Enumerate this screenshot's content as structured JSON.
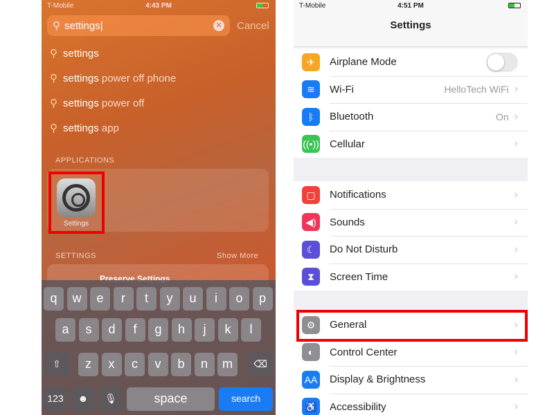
{
  "left": {
    "status": {
      "carrier": "T-Mobile",
      "time": "4:43 PM"
    },
    "search": {
      "value": "settings",
      "cancel": "Cancel"
    },
    "suggestions": [
      {
        "bold": "settings",
        "rest": ""
      },
      {
        "bold": "settings",
        "rest": " power off phone"
      },
      {
        "bold": "settings",
        "rest": " power off"
      },
      {
        "bold": "settings",
        "rest": " app"
      }
    ],
    "applications_header": "APPLICATIONS",
    "app": {
      "label": "Settings"
    },
    "settings_header": "SETTINGS",
    "show_more": "Show More",
    "partial_result": "Preserve Settings",
    "keyboard": {
      "row1": [
        "q",
        "w",
        "e",
        "r",
        "t",
        "y",
        "u",
        "i",
        "o",
        "p"
      ],
      "row2": [
        "a",
        "s",
        "d",
        "f",
        "g",
        "h",
        "j",
        "k",
        "l"
      ],
      "row3": [
        "z",
        "x",
        "c",
        "v",
        "b",
        "n",
        "m"
      ],
      "shift": "⇧",
      "delete": "⌫",
      "numbers": "123",
      "emoji": "☻",
      "mic": "🎙",
      "space": "space",
      "search": "search"
    }
  },
  "right": {
    "status": {
      "carrier": "T-Mobile",
      "time": "4:51 PM"
    },
    "title": "Settings",
    "groups": [
      [
        {
          "label": "Airplane Mode",
          "icon": "airplane-icon",
          "glyph": "✈",
          "color": "#f5a623",
          "toggle": false
        },
        {
          "label": "Wi-Fi",
          "icon": "wifi-icon",
          "glyph": "≋",
          "color": "#1a7cf5",
          "value": "HelloTech WiFi"
        },
        {
          "label": "Bluetooth",
          "icon": "bluetooth-icon",
          "glyph": "ᛒ",
          "color": "#1a7cf5",
          "value": "On"
        },
        {
          "label": "Cellular",
          "icon": "cellular-icon",
          "glyph": "((•))",
          "color": "#3bc456"
        }
      ],
      [
        {
          "label": "Notifications",
          "icon": "notifications-icon",
          "glyph": "▢",
          "color": "#f0423a"
        },
        {
          "label": "Sounds",
          "icon": "sounds-icon",
          "glyph": "◀)",
          "color": "#f0345a"
        },
        {
          "label": "Do Not Disturb",
          "icon": "moon-icon",
          "glyph": "☾",
          "color": "#5a4fd6"
        },
        {
          "label": "Screen Time",
          "icon": "hourglass-icon",
          "glyph": "⧗",
          "color": "#5a4fd6"
        }
      ],
      [
        {
          "label": "General",
          "icon": "gear-icon",
          "glyph": "⚙",
          "color": "#8e8e93"
        },
        {
          "label": "Control Center",
          "icon": "control-center-icon",
          "glyph": "◐",
          "color": "#8e8e93"
        },
        {
          "label": "Display & Brightness",
          "icon": "display-icon",
          "glyph": "AA",
          "color": "#1a7cf5"
        },
        {
          "label": "Accessibility",
          "icon": "accessibility-icon",
          "glyph": "♿",
          "color": "#1a7cf5"
        }
      ]
    ]
  },
  "colors": {
    "highlight": "#e00000",
    "toggle_off": "#e8e8e8",
    "ios_blue": "#1a7cf5"
  }
}
